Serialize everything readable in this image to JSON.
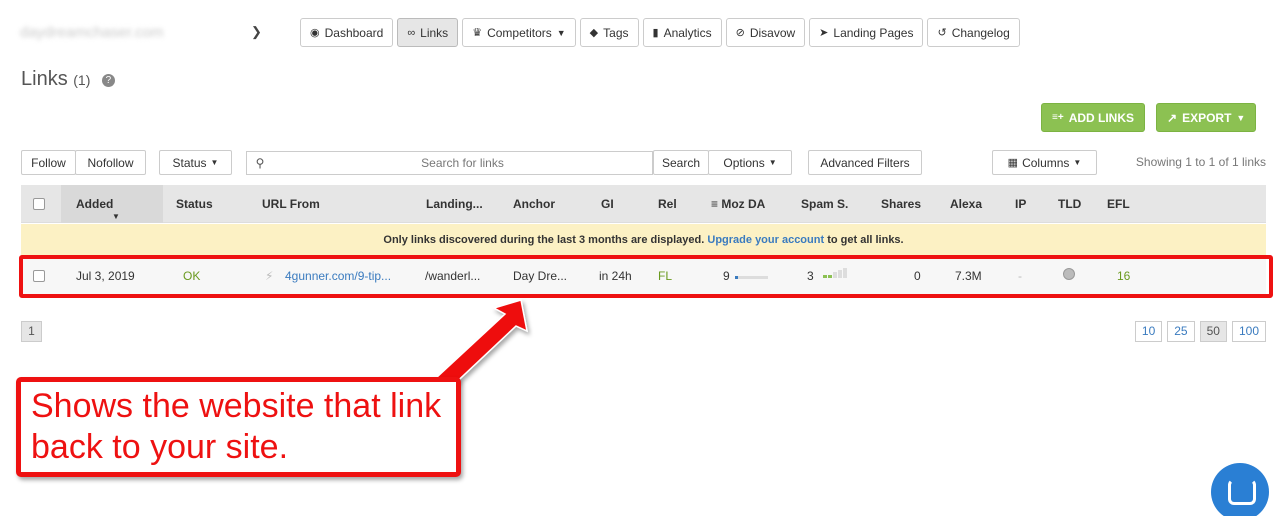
{
  "header": {
    "domain": "daydreamchaser.com",
    "nav": [
      {
        "icon": "dashboard-icon",
        "glyph": "◉",
        "label": "Dashboard"
      },
      {
        "icon": "link-icon",
        "glyph": "∞",
        "label": "Links"
      },
      {
        "icon": "trophy-icon",
        "glyph": "♛",
        "label": "Competitors"
      },
      {
        "icon": "tag-icon",
        "glyph": "◆",
        "label": "Tags"
      },
      {
        "icon": "bar-chart-icon",
        "glyph": "▮",
        "label": "Analytics"
      },
      {
        "icon": "ban-icon",
        "glyph": "⊘",
        "label": "Disavow"
      },
      {
        "icon": "send-icon",
        "glyph": "➤",
        "label": "Landing Pages"
      },
      {
        "icon": "history-icon",
        "glyph": "↺",
        "label": "Changelog"
      }
    ],
    "active_nav": "Links"
  },
  "page": {
    "title": "Links",
    "count": "(1)"
  },
  "actions": {
    "add_links": "ADD LINKS",
    "export": "EXPORT"
  },
  "filters": {
    "follow": "Follow",
    "nofollow": "Nofollow",
    "status": "Status",
    "search_placeholder": "Search for links",
    "search": "Search",
    "options": "Options",
    "advanced": "Advanced Filters",
    "columns": "Columns",
    "showing": "Showing 1 to 1 of 1 links"
  },
  "table": {
    "columns": [
      "Added",
      "Status",
      "URL From",
      "Landing...",
      "Anchor",
      "GI",
      "Rel",
      "Moz DA",
      "Spam S.",
      "Shares",
      "Alexa",
      "IP",
      "TLD",
      "EFL"
    ],
    "notice": {
      "text_before": "Only links discovered during the last 3 months are displayed.",
      "link": "Upgrade your account",
      "text_after": "to get all links."
    },
    "rows": [
      {
        "added": "Jul 3, 2019",
        "status": "OK",
        "url_from": "4gunner.com/9-tip...",
        "landing": "/wanderl...",
        "anchor": "Day Dre...",
        "gi": "in 24h",
        "rel": "FL",
        "moz_da": "9",
        "spam": "3",
        "shares": "0",
        "alexa": "7.3M",
        "ip": "-",
        "efl": "16"
      }
    ]
  },
  "pagination": {
    "current": "1",
    "sizes": [
      "10",
      "25",
      "50",
      "100"
    ],
    "active_size": "50"
  },
  "annotation": {
    "text": "Shows the website that link back to your site."
  },
  "colors": {
    "accent_green": "#8cc152",
    "link_blue": "#3a7bbf",
    "annotation_red": "#e11"
  }
}
